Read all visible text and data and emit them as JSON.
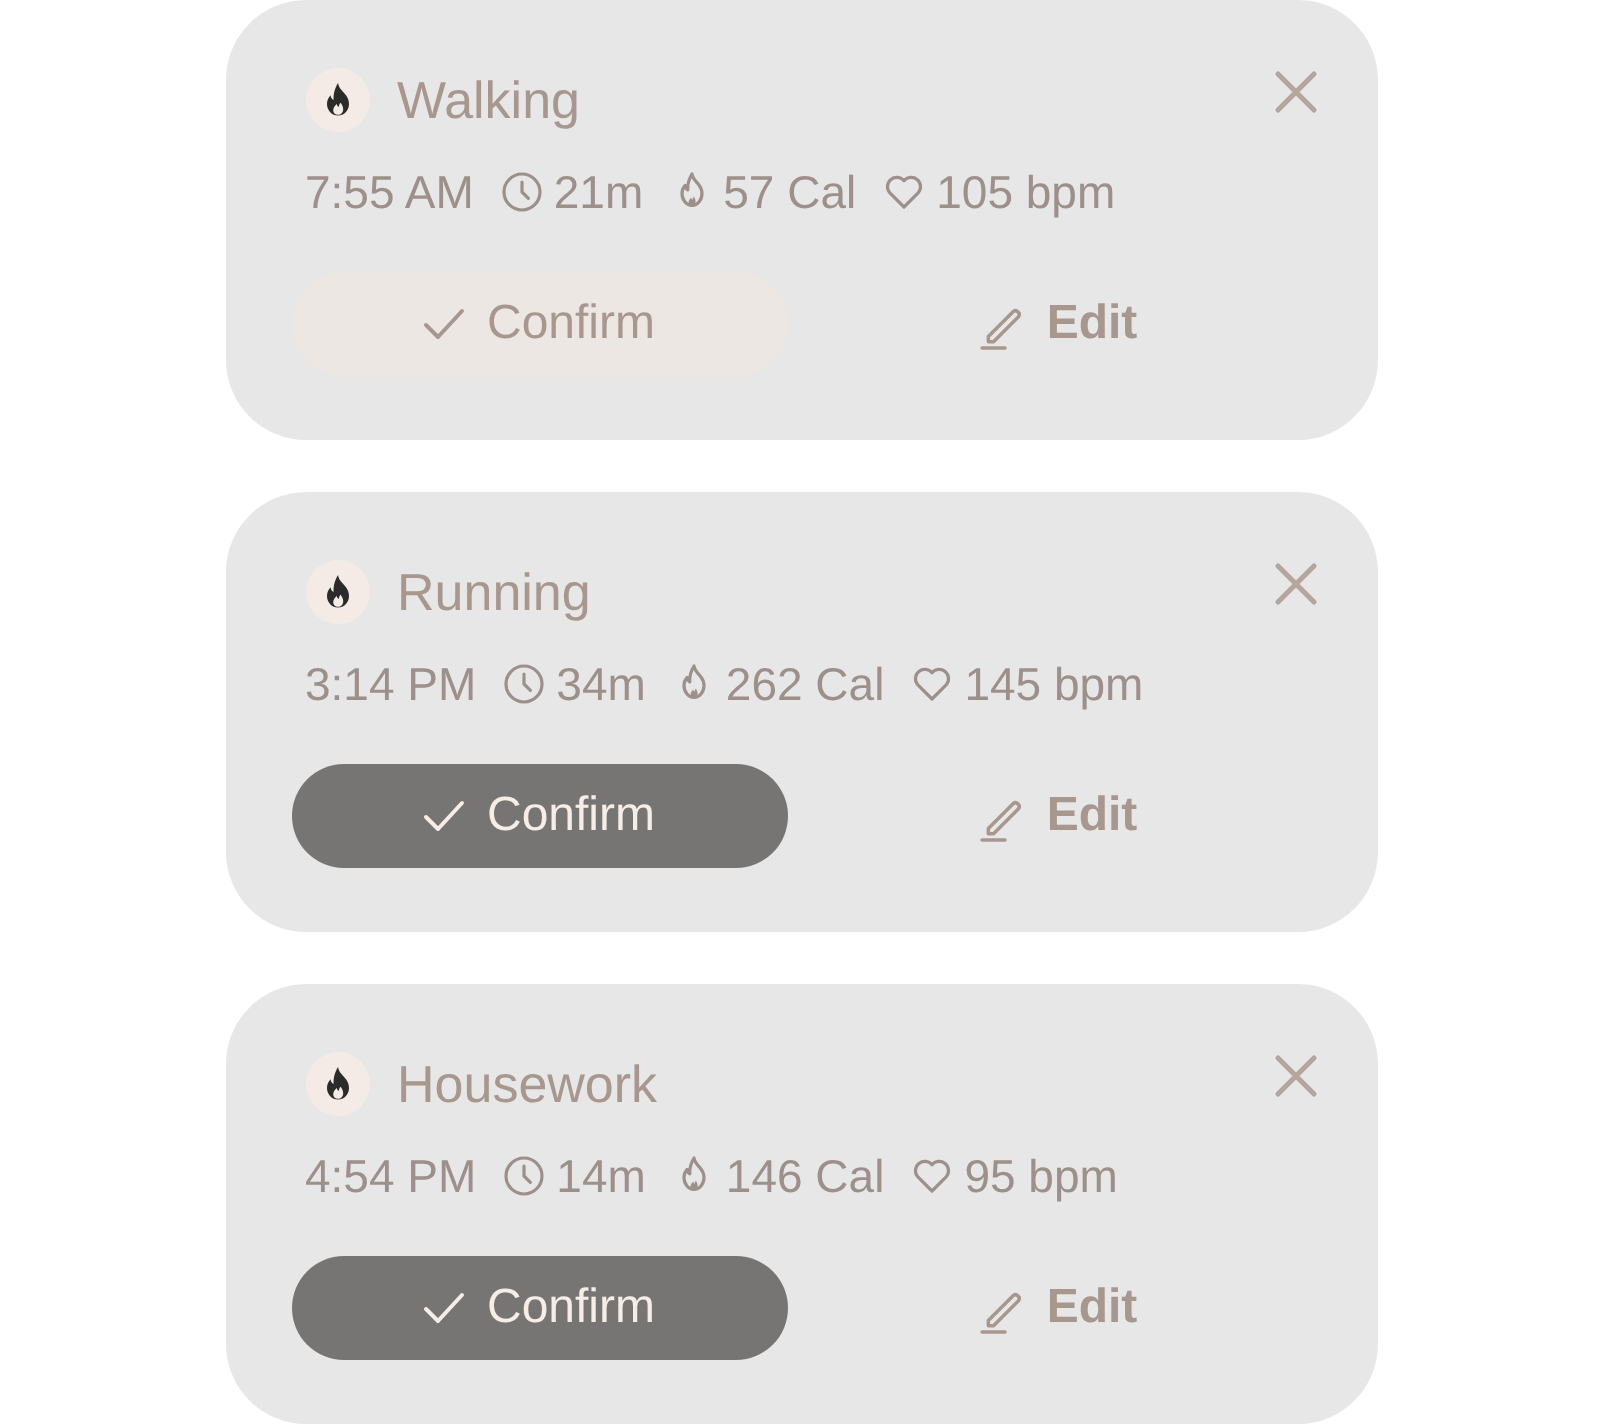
{
  "activities": [
    {
      "title": "Walking",
      "time": "7:55 AM",
      "duration": "21m",
      "calories": "57 Cal",
      "heart_rate": "105 bpm",
      "confirm": {
        "label": "Confirm",
        "disabled": true
      },
      "edit": {
        "label": "Edit"
      }
    },
    {
      "title": "Running",
      "time": "3:14 PM",
      "duration": "34m",
      "calories": "262 Cal",
      "heart_rate": "145 bpm",
      "confirm": {
        "label": "Confirm",
        "disabled": false
      },
      "edit": {
        "label": "Edit"
      }
    },
    {
      "title": "Housework",
      "time": "4:54 PM",
      "duration": "14m",
      "calories": "146 Cal",
      "heart_rate": "95 bpm",
      "confirm": {
        "label": "Confirm",
        "disabled": false
      },
      "edit": {
        "label": "Edit"
      }
    }
  ]
}
